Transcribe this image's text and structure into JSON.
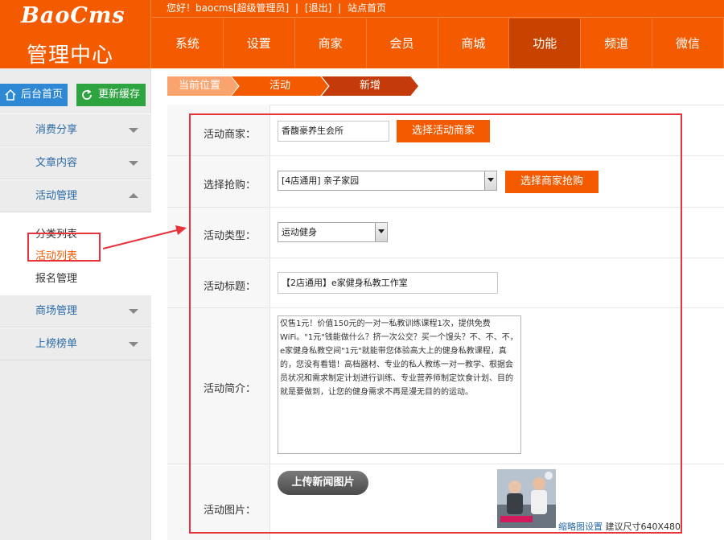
{
  "header": {
    "logo": "BaoCms",
    "logo_sub": "管理中心",
    "topbar": {
      "greeting": "您好！baocms[超级管理员]",
      "sep1": "|",
      "logout": "[退出]",
      "sep2": "|",
      "site_home": "站点首页"
    },
    "nav": [
      {
        "label": "系统"
      },
      {
        "label": "设置"
      },
      {
        "label": "商家"
      },
      {
        "label": "会员"
      },
      {
        "label": "商城"
      },
      {
        "label": "功能",
        "active": true
      },
      {
        "label": "频道"
      },
      {
        "label": "微信"
      }
    ]
  },
  "sidebar": {
    "home_button": "后台首页",
    "refresh_button": "更新缓存",
    "groups": [
      {
        "label": "消费分享"
      },
      {
        "label": "文章内容"
      },
      {
        "label": "活动管理"
      },
      {
        "label": "商场管理"
      },
      {
        "label": "上榜榜单"
      }
    ],
    "submenu": [
      {
        "label": "分类列表"
      },
      {
        "label": "活动列表",
        "current": true
      },
      {
        "label": "报名管理"
      }
    ]
  },
  "breadcrumb": [
    "当前位置",
    "活动",
    "新增"
  ],
  "form": {
    "merchant": {
      "label": "活动商家：",
      "value": "香馥豪养生会所",
      "button": "选择活动商家"
    },
    "group_buy": {
      "label": "选择抢购：",
      "value": "[4店通用] 亲子家园",
      "button": "选择商家抢购"
    },
    "type": {
      "label": "活动类型：",
      "value": "运动健身"
    },
    "title": {
      "label": "活动标题：",
      "value": "【2店通用】e家健身私教工作室"
    },
    "intro": {
      "label": "活动简介：",
      "value": "仅售1元！价值150元的一对一私教训练课程1次，提供免费WiFi。\"1元\"钱能做什么？挤一次公交？买一个馒头？不、不、不，e家健身私教空间\"1元\"就能带您体验高大上的健身私教课程，真的，您没有看错！高档器材、专业的私人教练一对一教学、根据会员状况和需求制定计划进行训练、专业营养师制定饮食计划、目的就是要做到，让您的健身需求不再是漫无目的的运动。"
    },
    "image": {
      "label": "活动图片：",
      "upload_button": "上传新闻图片",
      "thumb_link": "缩略图设置",
      "thumb_hint": "建议尺寸640X480"
    }
  },
  "colors": {
    "brand_orange": "#f45a00",
    "annotation_red": "#e8333a",
    "link_blue": "#2a6aa8"
  }
}
